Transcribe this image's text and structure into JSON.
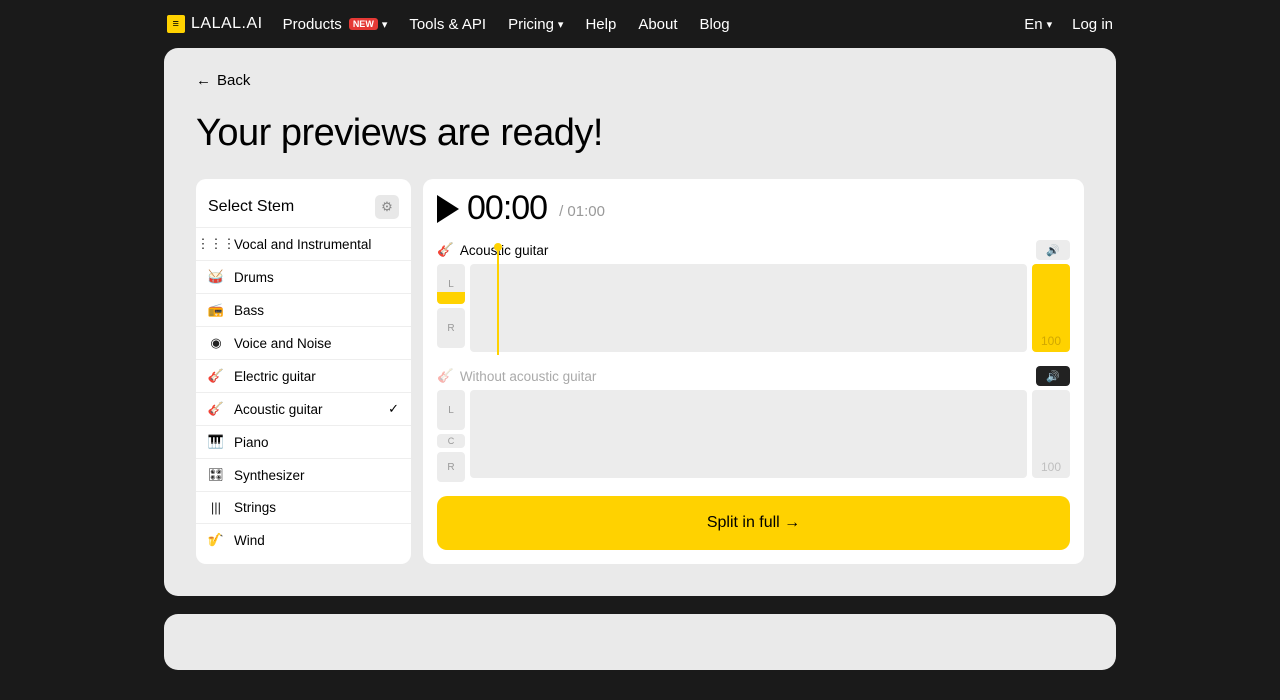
{
  "header": {
    "brand": "LALAL.AI",
    "nav": {
      "products": "Products",
      "products_badge": "NEW",
      "tools": "Tools & API",
      "pricing": "Pricing",
      "help": "Help",
      "about": "About",
      "blog": "Blog"
    },
    "lang": "En",
    "login": "Log in"
  },
  "main": {
    "back": "Back",
    "title": "Your previews are ready!",
    "sidebar": {
      "title": "Select Stem",
      "items": [
        {
          "icon": "waveform-icon",
          "glyph": "⋮⋮⋮",
          "label": "Vocal and Instrumental",
          "selected": false
        },
        {
          "icon": "drums-icon",
          "glyph": "🥁",
          "label": "Drums",
          "selected": false
        },
        {
          "icon": "bass-icon",
          "glyph": "📻",
          "label": "Bass",
          "selected": false
        },
        {
          "icon": "voice-icon",
          "glyph": "◉",
          "label": "Voice and Noise",
          "selected": false
        },
        {
          "icon": "electric-guitar-icon",
          "glyph": "🎸",
          "label": "Electric guitar",
          "selected": false
        },
        {
          "icon": "acoustic-guitar-icon",
          "glyph": "🎸",
          "label": "Acoustic guitar",
          "selected": true
        },
        {
          "icon": "piano-icon",
          "glyph": "🎹",
          "label": "Piano",
          "selected": false
        },
        {
          "icon": "synth-icon",
          "glyph": "🎛",
          "label": "Synthesizer",
          "selected": false
        },
        {
          "icon": "strings-icon",
          "glyph": "|||",
          "label": "Strings",
          "selected": false
        },
        {
          "icon": "wind-icon",
          "glyph": "🎷",
          "label": "Wind",
          "selected": false
        }
      ]
    },
    "player": {
      "current_time": "00:00",
      "total_time": "/ 01:00",
      "track_with": "Acoustic guitar",
      "track_without": "Without acoustic guitar",
      "channel_l": "L",
      "channel_c": "C",
      "channel_r": "R",
      "vol_with": "100",
      "vol_without": "100",
      "cta": "Split in full →"
    }
  }
}
